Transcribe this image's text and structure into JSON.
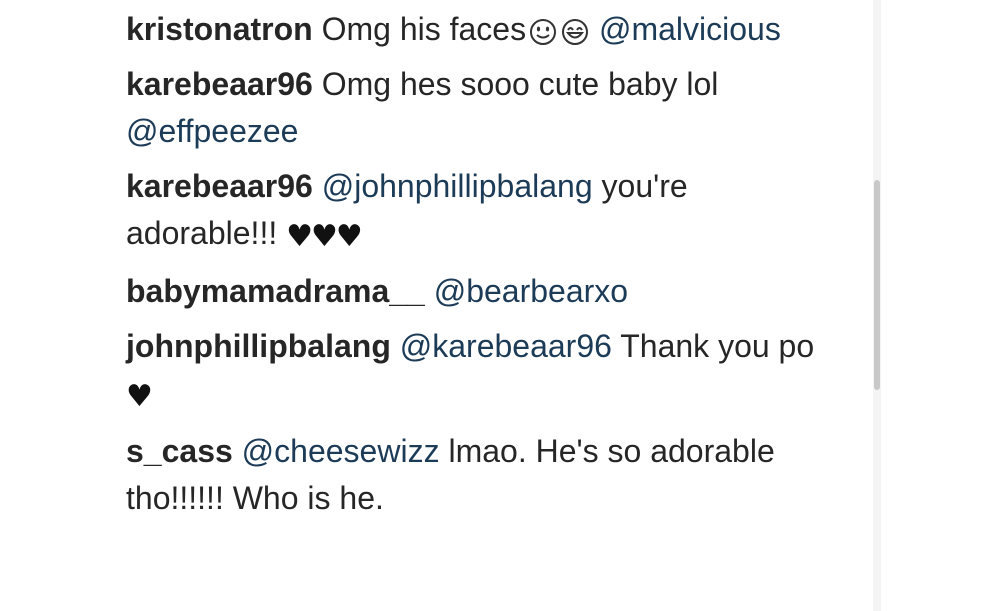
{
  "comments": [
    {
      "username": "kristonatron",
      "segments": [
        {
          "type": "text",
          "value": "Omg his faces"
        },
        {
          "type": "icon",
          "name": "smiley-face-emoji-icon"
        },
        {
          "type": "icon",
          "name": "grinning-face-emoji-icon"
        },
        {
          "type": "mention",
          "value": "@malvicious"
        }
      ]
    },
    {
      "username": "karebeaar96",
      "segments": [
        {
          "type": "text",
          "value": "Omg hes sooo cute baby lol"
        },
        {
          "type": "mention",
          "value": "@effpeezee"
        }
      ]
    },
    {
      "username": "karebeaar96",
      "segments": [
        {
          "type": "mention",
          "value": "@johnphillipbalang"
        },
        {
          "type": "text",
          "value": "you're adorable!!!"
        },
        {
          "type": "hearts",
          "value": "♥♥♥",
          "name": "black-hearts-emoji-icon"
        }
      ]
    },
    {
      "username": "babymamadrama__",
      "segments": [
        {
          "type": "mention",
          "value": "@bearbearxo"
        }
      ]
    },
    {
      "username": "johnphillipbalang",
      "segments": [
        {
          "type": "mention",
          "value": "@karebeaar96"
        },
        {
          "type": "text",
          "value": "Thank you po"
        },
        {
          "type": "hearts",
          "value": "♥",
          "name": "black-heart-emoji-icon"
        }
      ]
    },
    {
      "username": "s_cass",
      "segments": [
        {
          "type": "mention",
          "value": "@cheesewizz"
        },
        {
          "type": "text",
          "value": "lmao. He's so adorable tho!!!!!! Who is he."
        }
      ]
    }
  ],
  "colors": {
    "text": "#262626",
    "mention": "#1c3b57",
    "scrollbar_thumb": "#c8c8c8"
  }
}
